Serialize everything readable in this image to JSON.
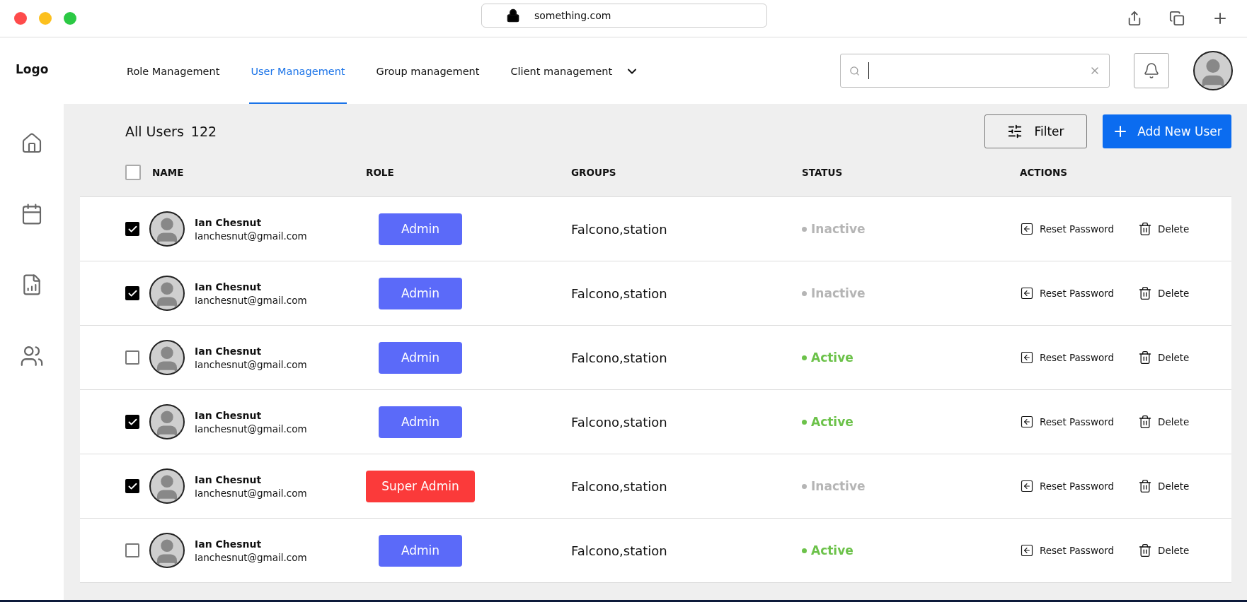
{
  "browser": {
    "url": "something.com"
  },
  "nav": {
    "logo": "Logo",
    "tabs": [
      {
        "label": "Role Management",
        "selected": false,
        "dropdown": false
      },
      {
        "label": "User Management",
        "selected": true,
        "dropdown": false
      },
      {
        "label": "Group management",
        "selected": false,
        "dropdown": false
      },
      {
        "label": "Client management",
        "selected": false,
        "dropdown": true
      }
    ]
  },
  "toolbar": {
    "title": "All Users",
    "count": "122",
    "filter": "Filter",
    "add": "Add New User"
  },
  "table": {
    "all_checked": false,
    "columns": [
      "NAME",
      "ROLE",
      "GROUPS",
      "STATUS",
      "ACTIONS"
    ],
    "rows": [
      {
        "checked": true,
        "name": "Ian Chesnut",
        "email": "Ianchesnut@gmail.com",
        "role": "Admin",
        "kind": "admin",
        "groups": "Falcono,station",
        "status": "Inactive",
        "active": false,
        "reset": "Reset Password",
        "delete": "Delete"
      },
      {
        "checked": true,
        "name": "Ian Chesnut",
        "email": "Ianchesnut@gmail.com",
        "role": "Admin",
        "kind": "admin",
        "groups": "Falcono,station",
        "status": "Inactive",
        "active": false,
        "reset": "Reset Password",
        "delete": "Delete"
      },
      {
        "checked": false,
        "name": "Ian Chesnut",
        "email": "Ianchesnut@gmail.com",
        "role": "Admin",
        "kind": "admin",
        "groups": "Falcono,station",
        "status": "Active",
        "active": true,
        "reset": "Reset Password",
        "delete": "Delete"
      },
      {
        "checked": true,
        "name": "Ian Chesnut",
        "email": "Ianchesnut@gmail.com",
        "role": "Admin",
        "kind": "admin",
        "groups": "Falcono,station",
        "status": "Active",
        "active": true,
        "reset": "Reset Password",
        "delete": "Delete"
      },
      {
        "checked": true,
        "name": "Ian Chesnut",
        "email": "Ianchesnut@gmail.com",
        "role": "Super Admin",
        "kind": "super",
        "groups": "Falcono,station",
        "status": "Inactive",
        "active": false,
        "reset": "Reset Password",
        "delete": "Delete"
      },
      {
        "checked": false,
        "name": "Ian Chesnut",
        "email": "Ianchesnut@gmail.com",
        "role": "Admin",
        "kind": "admin",
        "groups": "Falcono,station",
        "status": "Active",
        "active": true,
        "reset": "Reset Password",
        "delete": "Delete"
      }
    ]
  }
}
